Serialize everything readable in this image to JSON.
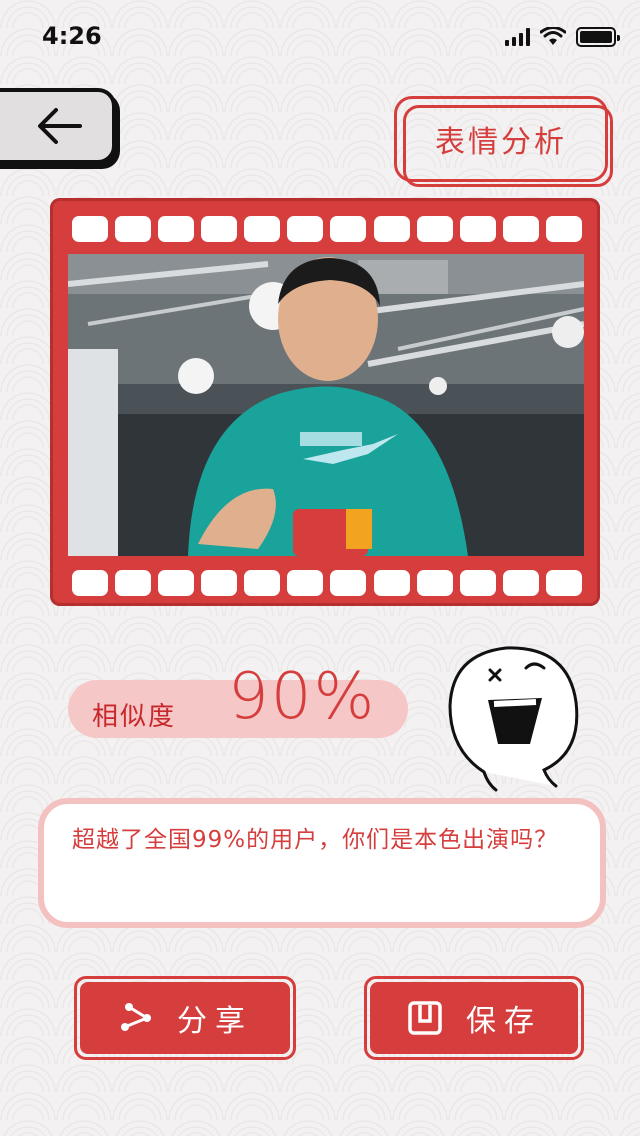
{
  "status_bar": {
    "time": "4:26",
    "icons": [
      "signal-icon",
      "wifi-icon",
      "battery-icon"
    ]
  },
  "header": {
    "back_icon": "arrow-left-icon",
    "title": "表情分析"
  },
  "result": {
    "similarity_label": "相似度",
    "similarity_value": "90%",
    "message": "超越了全国99%的用户，你们是本色出演吗？"
  },
  "actions": {
    "share_label": "分享",
    "share_icon": "share-icon",
    "save_label": "保存",
    "save_icon": "save-icon"
  },
  "colors": {
    "accent": "#d63d3d",
    "accent_light": "#f5c7c7",
    "background": "#f3f1f1"
  }
}
